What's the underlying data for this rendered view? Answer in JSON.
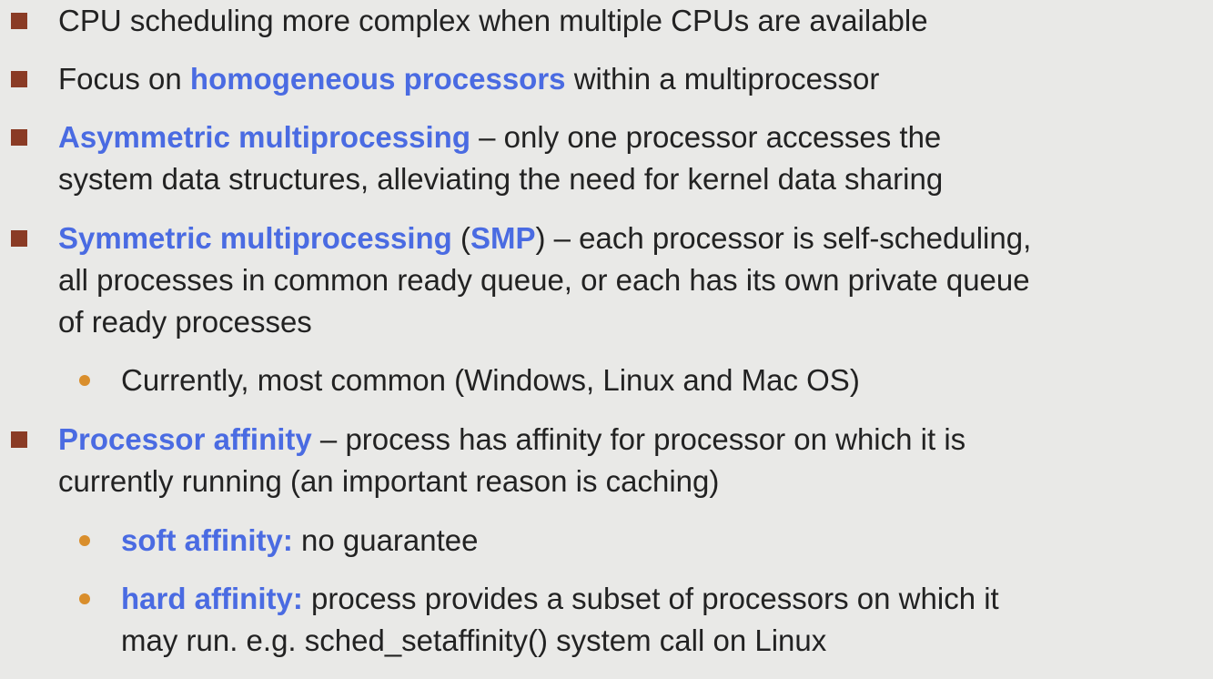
{
  "bullets": [
    {
      "lines": [
        "CPU scheduling more complex when multiple CPUs are available"
      ]
    },
    {
      "before": "Focus on ",
      "highlight": "homogeneous processors",
      "after": " within a multiprocessor"
    },
    {
      "highlight": "Asymmetric multiprocessing",
      "after": " – only one processor accesses the",
      "line2": "system data structures, alleviating the need for kernel data sharing"
    },
    {
      "highlight": "Symmetric multiprocessing",
      "paren_open": " (",
      "highlight2": "SMP",
      "after": ") – each processor is self-scheduling,",
      "line2": "all processes in common ready queue, or each has its own private queue",
      "line3": "of ready processes",
      "sub": [
        {
          "text": "Currently, most common (Windows, Linux and Mac OS)"
        }
      ]
    },
    {
      "highlight": "Processor affinity",
      "after": " – process has affinity for processor on which it is",
      "line2": "currently running (an important reason is caching)",
      "sub": [
        {
          "highlight": "soft affinity:",
          "after": " no guarantee"
        },
        {
          "highlight": "hard affinity:",
          "after": " process provides a subset of processors on which it",
          "line2": "may run. e.g. sched_setaffinity() system call on Linux"
        }
      ]
    }
  ],
  "colors": {
    "background": "#e9e9e7",
    "text": "#222222",
    "highlight": "#4a6be2",
    "square_bullet": "#8a3b25",
    "round_bullet": "#d98e2c"
  },
  "icons": {
    "main_bullet": "square-bullet-icon",
    "sub_bullet": "round-bullet-icon"
  }
}
